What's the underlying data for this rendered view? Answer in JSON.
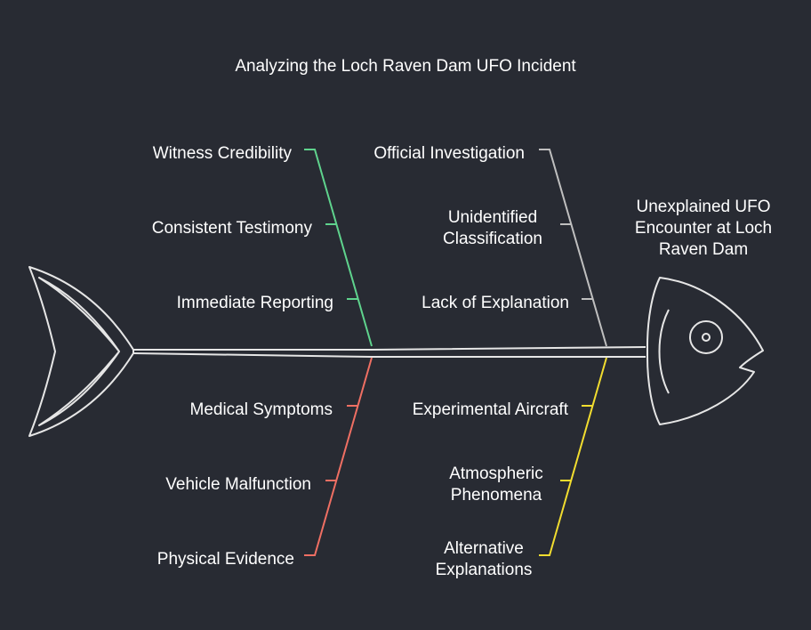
{
  "title": "Analyzing the Loch Raven Dam UFO Incident",
  "effect": "Unexplained UFO Encounter at Loch Raven Dam",
  "branches": {
    "top_left": {
      "color": "#5fd38d",
      "causes": [
        "Witness Credibility",
        "Consistent Testimony",
        "Immediate Reporting"
      ]
    },
    "top_right": {
      "color": "#bfbfbf",
      "causes": [
        "Official Investigation",
        "Unidentified Classification",
        "Lack of Explanation"
      ]
    },
    "bottom_left": {
      "color": "#ef6f63",
      "causes": [
        "Medical Symptoms",
        "Vehicle Malfunction",
        "Physical Evidence"
      ]
    },
    "bottom_right": {
      "color": "#f2dd2f",
      "causes": [
        "Experimental Aircraft",
        "Atmospheric Phenomena",
        "Alternative Explanations"
      ]
    }
  }
}
